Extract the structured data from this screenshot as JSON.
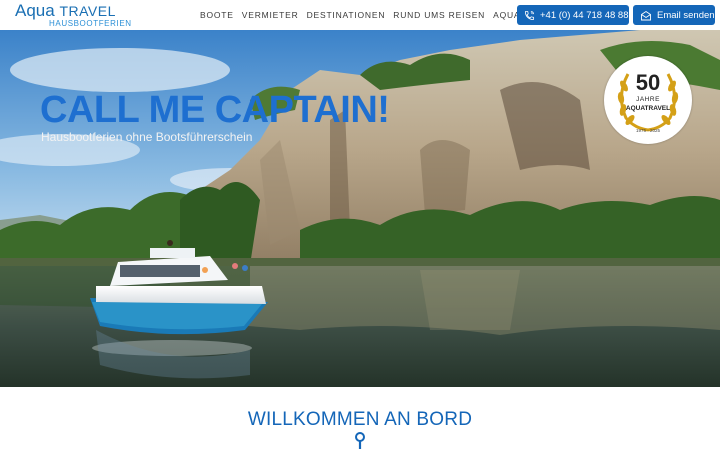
{
  "logo": {
    "brand_left": "Aqua",
    "brand_right": "TRAVEL",
    "tagline": "HAUSBOOTFERIEN"
  },
  "nav": {
    "items": [
      "BOOTE",
      "VERMIETER",
      "DESTINATIONEN",
      "RUND UMS REISEN",
      "AQUATRAVEL"
    ]
  },
  "contact": {
    "phone": "+41 (0) 44 718 48 88",
    "email_label": "Email senden"
  },
  "hero": {
    "title": "CALL ME CAPTAIN!",
    "subtitle": "Hausbootferien ohne Bootsführerschein",
    "badge": {
      "number": "50",
      "jahre": "JAHRE",
      "name": "AQUATRAVEL",
      "years": "1975 - 2025"
    }
  },
  "welcome": {
    "heading": "WILLKOMMEN AN BORD"
  },
  "colors": {
    "brand_blue": "#1466b8",
    "title_blue": "#1e6fd0",
    "badge_gold": "#d4a017"
  },
  "icons": {
    "phone": "phone-icon",
    "mail": "mail-icon",
    "pin": "location-pin-icon",
    "laurel": "laurel-wreath-icon"
  }
}
